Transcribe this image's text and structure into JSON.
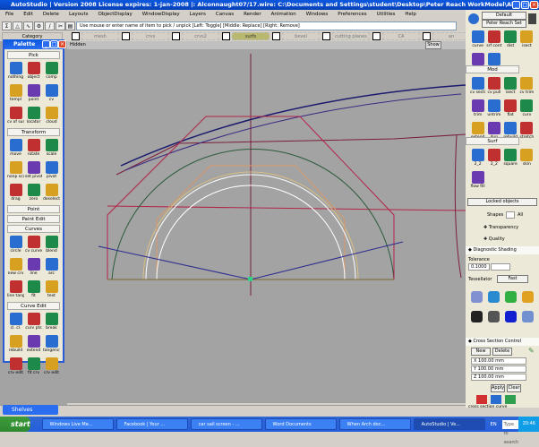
{
  "window": {
    "title": "AutoStudio | Version 2008 License expires: 1-jan-2008 |: Alconnaught07/17.wire: C:\\Documents and Settings\\student\\Desktop\\Peter Reach WorkModel\\Alconnaught07/17.wire"
  },
  "menu": [
    "File",
    "Edit",
    "Delete",
    "Layouts",
    "ObjectDisplay",
    "WindowDisplay",
    "Layers",
    "Canvas",
    "Render",
    "Animation",
    "Windows",
    "Preferences",
    "Utilities",
    "Help"
  ],
  "toolbar": {
    "category_label": "Category",
    "prompt": "Use mouse or enter name of item to pick / unpick [Left: Toggle] [Middle: Replace] [Right: Remove]"
  },
  "layers": [
    "mesh",
    "crvs",
    "crvs2",
    "surfs",
    "bevel",
    "cutting planes",
    "CA",
    "an"
  ],
  "viewport": {
    "label": "Hidden",
    "show_button": "Show",
    "colors": {
      "background": "#a3a3a3"
    }
  },
  "palette": {
    "title": "Palette",
    "sections": [
      {
        "name": "Pick",
        "items": [
          "nothing",
          "object",
          "comp",
          "templ",
          "point",
          "cv",
          "cv of surf",
          "locator",
          "cloud"
        ]
      },
      {
        "name": "Transform",
        "items": [
          "move",
          "rotate",
          "scale",
          "nonp scale",
          "set pivot",
          "pivot",
          "drag",
          "zero",
          "deselect"
        ]
      },
      {
        "name": "Point"
      },
      {
        "name": "Paint Edit"
      },
      {
        "name": "Curves",
        "items": [
          "circle",
          "cv curve",
          "blend",
          "new crv",
          "line",
          "arc",
          "line tangent",
          "fit",
          "text"
        ]
      },
      {
        "name": "Curve Edit",
        "items": [
          "cl. cl.",
          "curv pts",
          "break",
          "rebuild",
          "extend",
          "tangency",
          "crv edit",
          "fit crv",
          "crv edit"
        ]
      }
    ]
  },
  "right_panel": {
    "shelf_default": "Default",
    "shelf_name": "Peter Reach Set",
    "top_items": [
      "curve",
      "srf cont",
      "dist",
      "isect",
      "persp",
      "qkedit"
    ],
    "surf_edit_tab": "Mod",
    "surf_edit_items": [
      "cv section",
      "cv pull",
      "isect",
      "cv trim",
      "trim",
      "untrim",
      "flat",
      "curv",
      "extend",
      "dup",
      "rebuild",
      "stretch"
    ],
    "surf_tab": "Surf",
    "surf_items": [
      "2_2",
      "2_2",
      "square",
      "skin",
      "flow fill"
    ],
    "locked_objects": "Locked objects",
    "shapes_label": "Shapes",
    "shapes_all": "All",
    "transparency": "Transparency",
    "quality": "Quality",
    "diagnostic_shading": "Diagnostic Shading",
    "tolerance_label": "Tolerance",
    "tolerance_value": "0.1000",
    "tessellator_label": "Tessellator",
    "tessellator_value": "Fast",
    "cross_section": "Cross Section Control",
    "new_button": "New",
    "delete_button": "Delete",
    "x_value": "X 100.00 mm",
    "y_value": "Y 100.00 mm",
    "z_value": "Z 100.00 mm",
    "apply_button": "Apply",
    "clear_button": "Clear",
    "bottom_label": "cross section    curve"
  },
  "shelves": {
    "title": "Shelves"
  },
  "taskbar": {
    "start": "start",
    "tasks": [
      "Windows Live Me...",
      "Facebook | Your ...",
      "car sail screen - ...",
      "Word Documents",
      "When Arch doc...",
      "AutoStudio | Ve..."
    ],
    "active_index": 5,
    "search_placeholder": "Type to search",
    "lang": "EN",
    "clock": "20:46"
  }
}
